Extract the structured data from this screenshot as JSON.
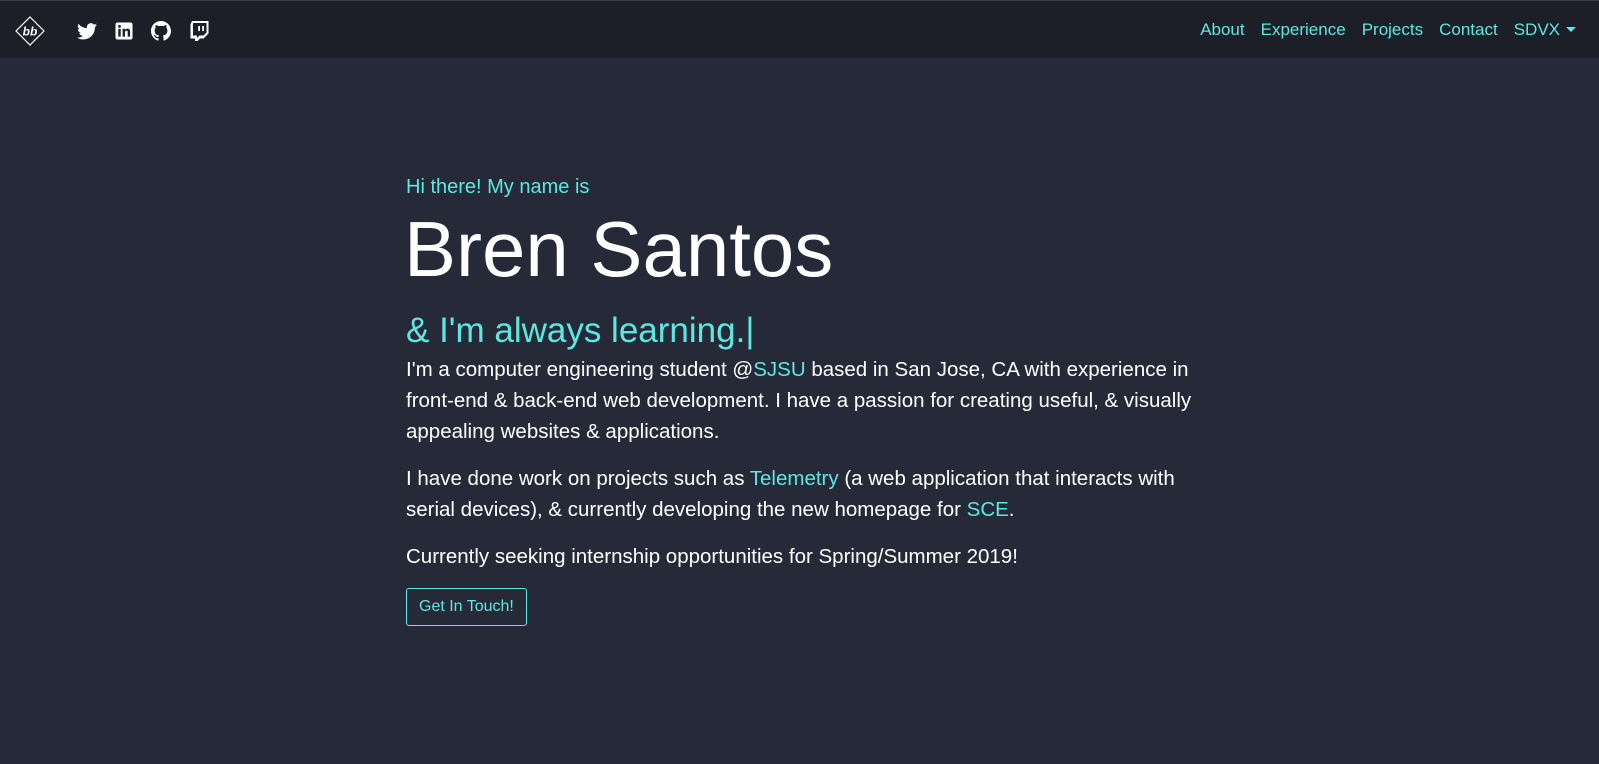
{
  "navbar": {
    "logo": {
      "text": "bb",
      "icon": "bb-diamond-logo"
    },
    "social_icons": [
      "twitter-icon",
      "linkedin-icon",
      "github-icon",
      "twitch-icon"
    ],
    "links": [
      "About",
      "Experience",
      "Projects",
      "Contact"
    ],
    "dropdown_label": "SDVX"
  },
  "hero": {
    "greeting": "Hi there! My name is",
    "name": "Bren Santos",
    "tagline": "& I'm always learning.",
    "cursor": "|",
    "paragraph1": {
      "before": "I'm a computer engineering student @",
      "link": "SJSU",
      "after": " based in San Jose, CA with experience in front-end & back-end web development. I have a passion for creating useful, & visually appealing websites & applications."
    },
    "paragraph2": {
      "before": "I have done work on projects such as ",
      "link1": "Telemetry",
      "middle": " (a web application that interacts with serial devices), & currently developing the new homepage for ",
      "link2": "SCE",
      "after": "."
    },
    "paragraph3": "Currently seeking internship opportunities for Spring/Summer 2019!",
    "cta_label": "Get In Touch!"
  },
  "colors": {
    "background": "#262a38",
    "navbar": "#1c1f27",
    "accent": "#5ce8e1",
    "text": "#ffffff"
  }
}
